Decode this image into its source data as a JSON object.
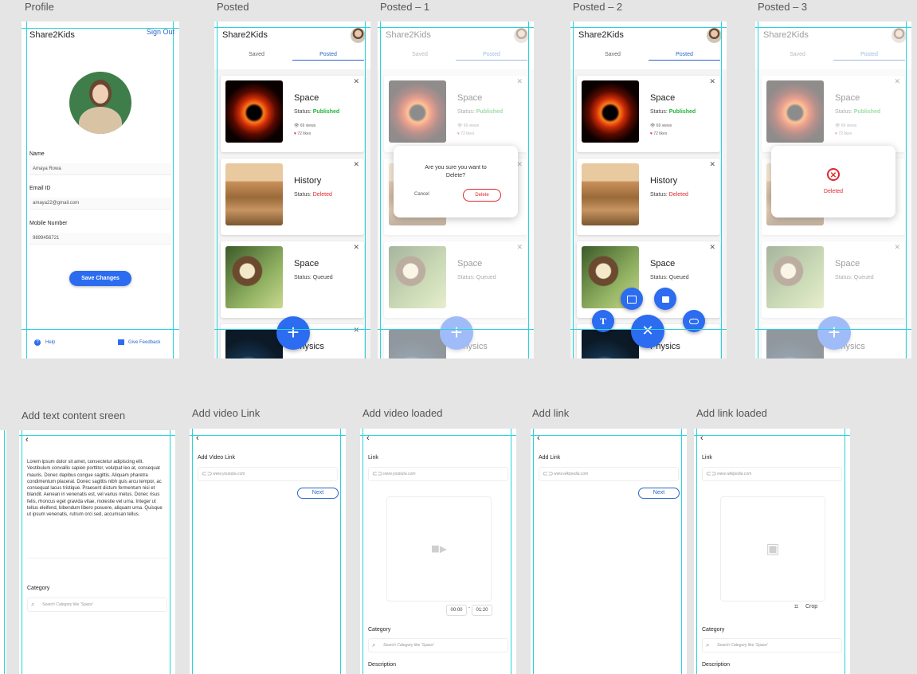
{
  "artboards": {
    "profile": {
      "label": "Profile",
      "brand": "Share2Kids",
      "sign_out": "Sign Out",
      "fields": [
        {
          "label": "Name",
          "value": "Amaya Rowa"
        },
        {
          "label": "Email ID",
          "value": "amaya22@gmail.com"
        },
        {
          "label": "Mobile Number",
          "value": "9899456721"
        }
      ],
      "save_label": "Save Changes",
      "help_label": "Help",
      "feedback_label": "Give Feedback"
    },
    "posted": {
      "label": "Posted",
      "brand": "Share2Kids",
      "tabs": [
        "Saved",
        "Posted"
      ],
      "cards": [
        {
          "title": "Space",
          "status_label": "Status:",
          "status": "Published",
          "views": "69 views",
          "likes": "72 likes"
        },
        {
          "title": "History",
          "status_label": "Status:",
          "status": "Deleted"
        },
        {
          "title": "Space",
          "status_label": "Status:",
          "status": "Queued"
        },
        {
          "title": "Physics"
        }
      ],
      "fab": "+"
    },
    "posted1": {
      "label": "Posted – 1",
      "dialog_text": "Are you sure you want to",
      "dialog_text2": "Delete?",
      "cancel_label": "Cancel",
      "delete_label": "Delete"
    },
    "posted2": {
      "label": "Posted – 2",
      "fab_close": "✕",
      "fab_text": "T"
    },
    "posted3": {
      "label": "Posted – 3",
      "deleted_text": "Deleted"
    },
    "add_text": {
      "label": "Add text content sreen",
      "body": "Lorem ipsum dolor sit amet, consectetur adipiscing elit. Vestibulum convallis sapien porttitor, volutpat leo at, consequat mauris. Donec dapibus congue sagittis. Aliquam pharetra condimentum placerat. Donec sagittis nibh quis arcu tempor, ac consequat lacus tristique. Praesent dictum fermentum nisi et blandit. Aenean in venenatis est, vel varius metus. Donec risus felis, rhoncus eget gravida vitae, molestie vel urna. Integer ut tellus eleifend, bibendum libero posuere, aliquam urna. Quisque ut ipsum venenatis, rutrum orci sed, accumsan tellus.",
      "category_label": "Category",
      "search_placeholder": "Search Category like 'Space'"
    },
    "add_video": {
      "label": "Add video Link",
      "title": "Add Video Link",
      "placeholder": "www.youtube.com",
      "next_label": "Next"
    },
    "add_video_loaded": {
      "label": "Add video loaded",
      "link_label": "Link",
      "placeholder": "www.youtube.com",
      "time_start": "00:00",
      "time_sep": "-",
      "time_end": "01:20",
      "category_label": "Category",
      "search_placeholder": "Search Category like 'Space'",
      "description_label": "Description"
    },
    "add_link": {
      "label": "Add link",
      "title": "Add Link",
      "placeholder": "www.wikipedia.com",
      "next_label": "Next"
    },
    "add_link_loaded": {
      "label": "Add link loaded",
      "link_label": "Link",
      "placeholder": "www.wikipedia.com",
      "crop_label": "Crop",
      "category_label": "Category",
      "search_placeholder": "Search Category like 'Space'",
      "description_label": "Description"
    }
  },
  "colors": {
    "accent": "#2b6cf0",
    "published": "#23b23a",
    "deleted": "#e0262c",
    "guide": "#27d3de",
    "canvas": "#e5e5e5"
  }
}
